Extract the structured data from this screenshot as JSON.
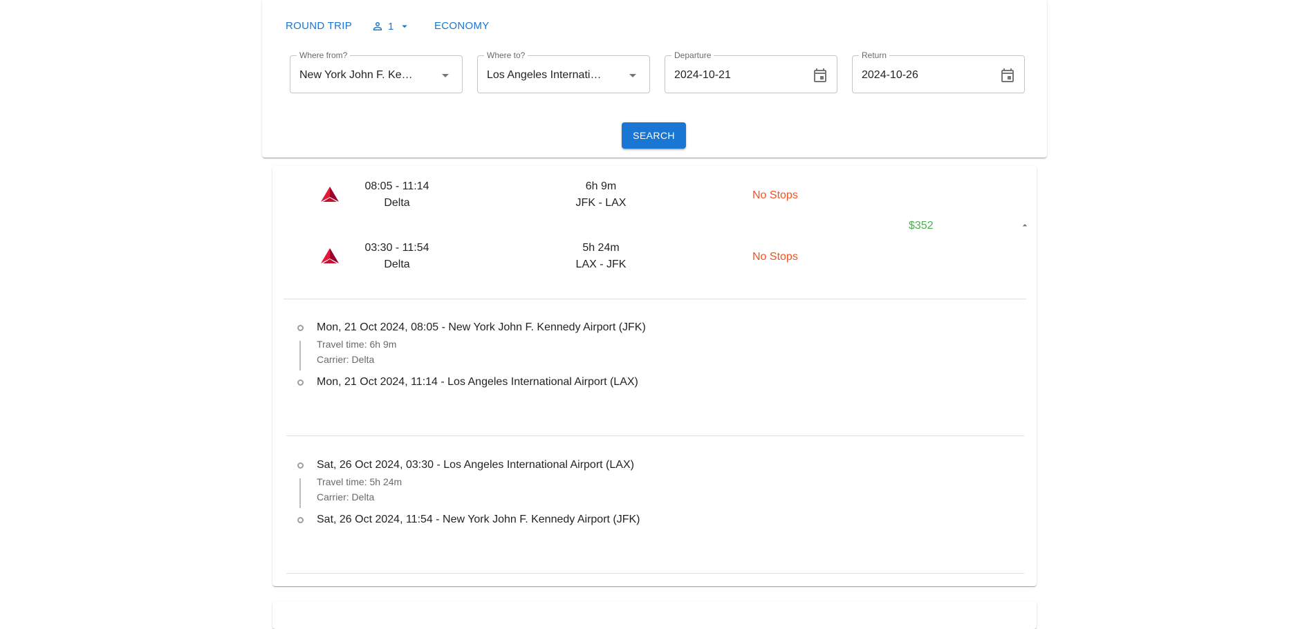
{
  "search": {
    "trip_type": "ROUND TRIP",
    "passengers": "1",
    "cabin_class": "ECONOMY",
    "from": {
      "label": "Where from?",
      "value": "New York John F. Kennedy Airport"
    },
    "to": {
      "label": "Where to?",
      "value": "Los Angeles International Airport"
    },
    "departure": {
      "label": "Departure",
      "value": "2024-10-21"
    },
    "return": {
      "label": "Return",
      "value": "2024-10-26"
    },
    "search_label": "SEARCH"
  },
  "result": {
    "price": "$352",
    "outbound": {
      "times": "08:05 - 11:14",
      "airline": "Delta",
      "duration": "6h 9m",
      "route": "JFK - LAX",
      "stops": "No Stops"
    },
    "inbound": {
      "times": "03:30 - 11:54",
      "airline": "Delta",
      "duration": "5h 24m",
      "route": "LAX - JFK",
      "stops": "No Stops"
    },
    "details": [
      {
        "depart": "Mon, 21 Oct 2024, 08:05 - New York John F. Kennedy Airport (JFK)",
        "travel_time": "Travel time: 6h 9m",
        "carrier": "Carrier: Delta",
        "arrive": "Mon, 21 Oct 2024, 11:14 - Los Angeles International Airport (LAX)"
      },
      {
        "depart": "Sat, 26 Oct 2024, 03:30 - Los Angeles International Airport (LAX)",
        "travel_time": "Travel time: 5h 24m",
        "carrier": "Carrier: Delta",
        "arrive": "Sat, 26 Oct 2024, 11:54 - New York John F. Kennedy Airport (JFK)"
      }
    ]
  },
  "colors": {
    "primary": "#1976d2",
    "stops": "#f4511e",
    "price": "#4caf50",
    "delta_red": "#c8102e"
  }
}
